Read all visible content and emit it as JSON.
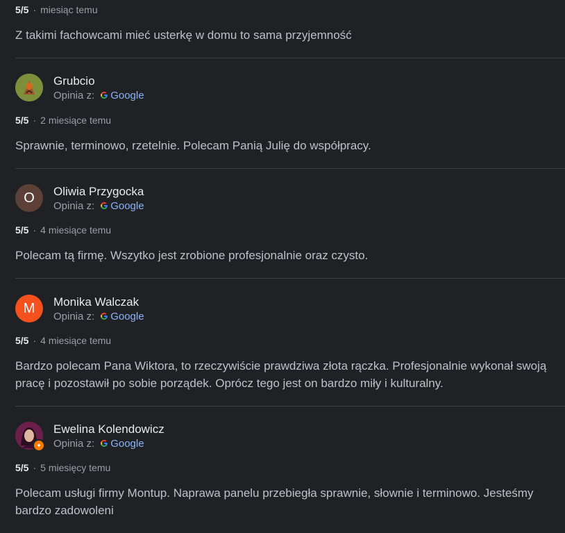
{
  "separator": "·",
  "first_review": {
    "score": "5/5",
    "date": "miesiąc temu",
    "text": "Z takimi fachowcami mieć usterkę w domu to sama przyjemność"
  },
  "reviews": [
    {
      "author": "Grubcio",
      "source_label": "Opinia z:",
      "source_name": "Google",
      "score": "5/5",
      "date": "2 miesiące temu",
      "text": "Sprawnie, terminowo, rzetelnie. Polecam Panią Julię do współpracy.",
      "avatar_color": "#6a7b2e"
    },
    {
      "author": "Oliwia Przygocka",
      "source_label": "Opinia z:",
      "source_name": "Google",
      "score": "5/5",
      "date": "4 miesiące temu",
      "text": "Polecam tą firmę. Wszytko jest zrobione profesjonalnie oraz czysto.",
      "avatar_letter": "O",
      "avatar_color": "#5d4037"
    },
    {
      "author": "Monika Walczak",
      "source_label": "Opinia z:",
      "source_name": "Google",
      "score": "5/5",
      "date": "4 miesiące temu",
      "text_line1": "Bardzo polecam Pana Wiktora, to rzeczywiście prawdziwa złota rączka. Profesjonalnie wykonał swoją",
      "text_line2": "pracę i pozostawił po sobie porządek. Oprócz tego jest on bardzo miły i kulturalny.",
      "avatar_letter": "M",
      "avatar_color": "#f4511e"
    },
    {
      "author": "Ewelina Kolendowicz",
      "source_label": "Opinia z:",
      "source_name": "Google",
      "score": "5/5",
      "date": "5 miesięcy temu",
      "text_line1": "Polecam usługi firmy Montup. Naprawa panelu przebiegła sprawnie, słownie i terminowo. Jesteśmy",
      "text_line2": "bardzo zadowoleni",
      "avatar_color": "#8e2a5a"
    }
  ],
  "colors": {
    "background": "#202124",
    "text": "#bdc1c6",
    "link": "#8ab4f8",
    "divider": "#3c4043"
  }
}
